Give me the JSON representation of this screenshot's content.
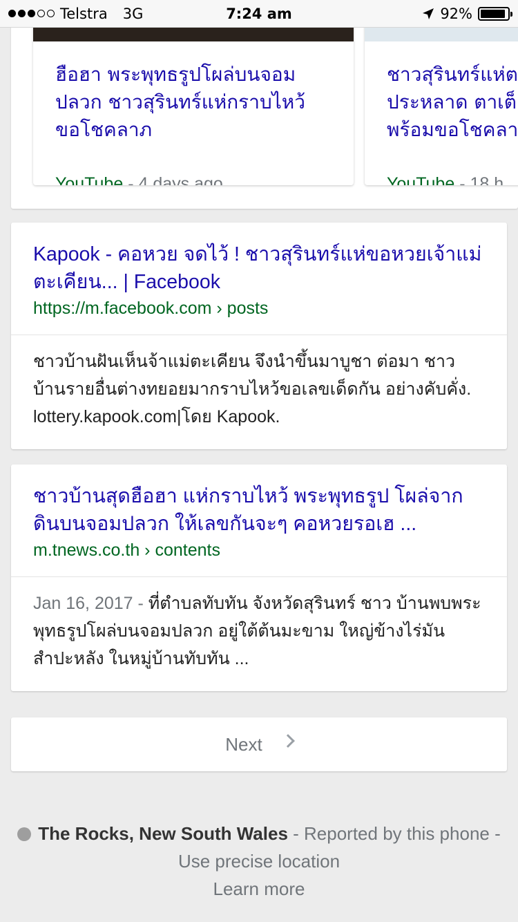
{
  "status": {
    "carrier": "Telstra",
    "network": "3G",
    "time": "7:24 am",
    "battery": "92%",
    "battery_level": 0.92
  },
  "videos": [
    {
      "title": "ฮือฮา พระพุทธรูปโผล่บนจอม\nปลวก ชาวสุรินทร์แห่กราบไหว้\nขอโชคลาภ",
      "source": "YouTube",
      "sep": " - ",
      "age": "4 days ago"
    },
    {
      "title": "ชาวสุรินทร์แห่ต\nประหลาด ตาเต็\nพร้อมขอโชคลา",
      "source": "YouTube",
      "sep": " - ",
      "age": "18 h"
    }
  ],
  "results": [
    {
      "title": "Kapook - คอหวย จดไว้ ! ชาวสุรินทร์แห่ขอหวยเจ้าแม่ตะเคียน... | Facebook",
      "url": "https://m.facebook.com › posts",
      "date": "",
      "snippet": "ชาวบ้านฝันเห็นจ้าแม่ตะเคียน จึงนำขึ้นมาบูชา ต่อมา ชาวบ้านรายอื่นต่างทยอยมากราบไหว้ขอเลขเด็ดกัน อย่างคับคั่ง. lottery.kapook.com|โดย Kapook."
    },
    {
      "title": "ชาวบ้านสุดฮือฮา แห่กราบไหว้ พระพุทธรูป โผล่จากดินบนจอมปลวก ให้เลขกันจะๆ คอหวยรอเฮ ...",
      "url": "m.tnews.co.th › contents",
      "date": "Jan 16, 2017 - ",
      "snippet": "ที่ตำบลทับทัน จังหวัดสุรินทร์ ชาว บ้านพบพระพุทธรูปโผล่บนจอมปลวก อยู่ใต้ต้นมะขาม ใหญ่ข้างไร่มันสำปะหลัง ในหมู่บ้านทับทัน ..."
    }
  ],
  "pagination": {
    "next_label": "Next"
  },
  "footer": {
    "location": "The Rocks, New South Wales",
    "reported": " - Reported by this phone",
    "precise": " - Use precise location",
    "learn_more": "Learn more"
  },
  "colors": {
    "link": "#1a0dab",
    "url": "#006621",
    "muted": "#70757a",
    "background": "#ececec"
  }
}
